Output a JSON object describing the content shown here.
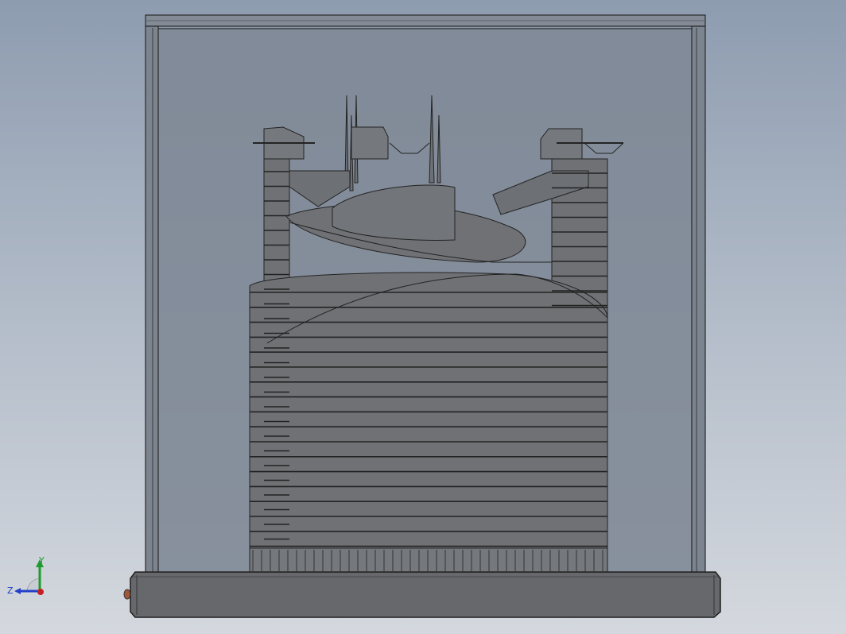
{
  "viewport": {
    "background_top": "#8e9cb0",
    "background_bottom": "#d4d8de"
  },
  "model": {
    "part_name": "glass-enclosed-building-model",
    "glass_color": "#7f8896",
    "frame_color": "#6c7480",
    "building_color": "#6f7175",
    "base_color": "#66686b",
    "edge_color": "#232323"
  },
  "triad": {
    "x_label": "",
    "y_label": "Y",
    "z_label": "Z",
    "y_color": "#1f9a2e",
    "x_color": "#c42020",
    "z_color": "#2240c8"
  }
}
